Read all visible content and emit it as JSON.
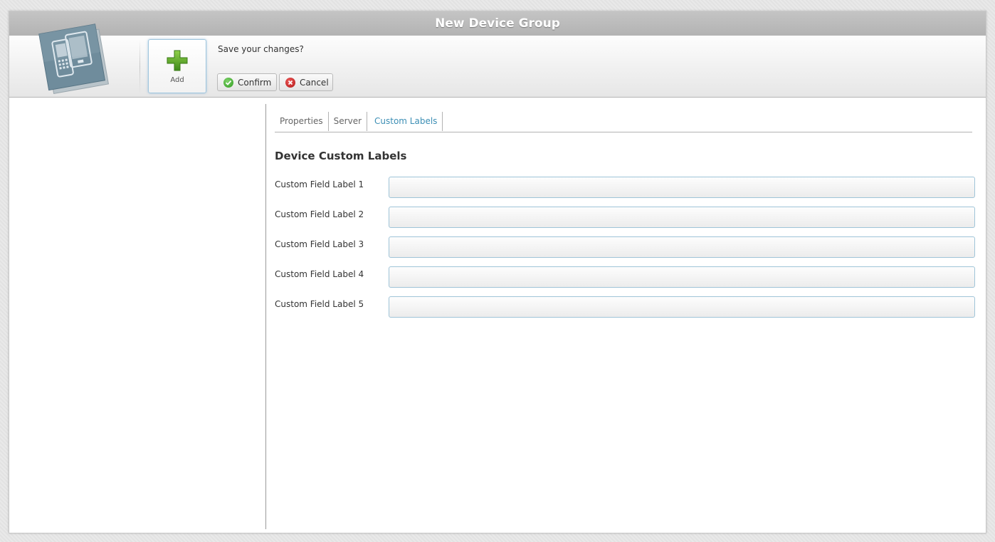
{
  "window": {
    "title": "New Device Group"
  },
  "toolbar": {
    "app_icon": "device-group-icon",
    "add_label": "Add",
    "add_icon": "plus-icon",
    "prompt": "Save your changes?",
    "confirm_label": "Confirm",
    "confirm_icon": "check-circle-icon",
    "cancel_label": "Cancel",
    "cancel_icon": "x-circle-icon"
  },
  "tabs": [
    {
      "label": "Properties",
      "active": false
    },
    {
      "label": "Server",
      "active": false
    },
    {
      "label": "Custom Labels",
      "active": true
    }
  ],
  "section": {
    "title": "Device Custom Labels",
    "fields": [
      {
        "label": "Custom Field Label 1",
        "value": ""
      },
      {
        "label": "Custom Field Label 2",
        "value": ""
      },
      {
        "label": "Custom Field Label 3",
        "value": ""
      },
      {
        "label": "Custom Field Label 4",
        "value": ""
      },
      {
        "label": "Custom Field Label 5",
        "value": ""
      }
    ]
  },
  "colors": {
    "titlebar": "#b8b8b8",
    "active_tab": "#3d8fb5",
    "input_border": "#9fc4d8",
    "confirm_icon": "#3a9e2a",
    "cancel_icon": "#c21b1b",
    "plus_icon": "#5aa328"
  }
}
